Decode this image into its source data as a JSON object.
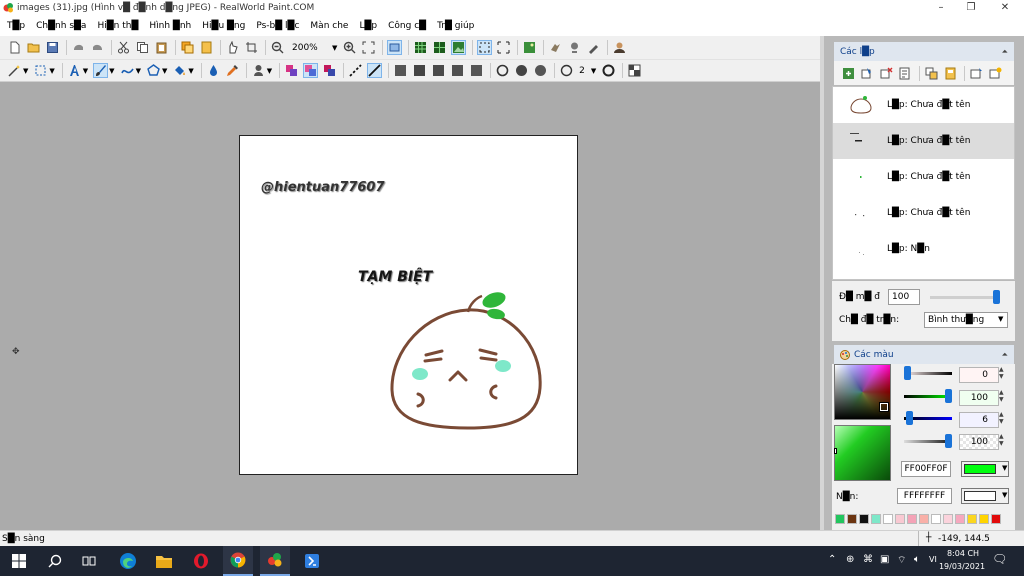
{
  "window": {
    "title": "images (31).jpg (Hình v█ đ█nh d█ng JPEG) - RealWorld Paint.COM",
    "minimize": "–",
    "maximize": "❐",
    "close": "✕"
  },
  "menu": [
    "T█p",
    "Ch█nh s█a",
    "Hi█n th█",
    "Hình █nh",
    "Hi█u █ng",
    "Ps-b█ l█c",
    "Màn che",
    "L█p",
    "Công c█",
    "Tr█ giúp"
  ],
  "toolbar": {
    "zoom_value": "200%",
    "brush_size": "2"
  },
  "canvas": {
    "watermark": "@hientuan77607",
    "caption": "TẠM BIỆT"
  },
  "layers_panel": {
    "title": "Các l█p",
    "items": [
      {
        "name": "L█p: Chưa đ█t tên"
      },
      {
        "name": "L█p: Chưa đ█t tên"
      },
      {
        "name": "L█p: Chưa đ█t tên"
      },
      {
        "name": "L█p: Chưa đ█t tên"
      },
      {
        "name": "L█p: N█n"
      }
    ],
    "opacity_label": "Đ█ m█ đ",
    "opacity_value": "100",
    "opacity_fraction": 1.0,
    "blend_label": "Ch█ đ█ tr█n:",
    "blend_value": "Bình thư█ng"
  },
  "colors_panel": {
    "title": "Các màu",
    "sliders": [
      {
        "value": "0",
        "fraction": 0.0
      },
      {
        "value": "100",
        "fraction": 1.0
      },
      {
        "value": "6",
        "fraction": 0.06
      },
      {
        "value": "100",
        "fraction": 1.0
      }
    ],
    "foreground_hex_text": "FF00FF0F",
    "background_label": "N█n:",
    "background_hex_text": "FFFFFFFF",
    "foreground_color": "#00ff0f",
    "background_color": "#ffffff",
    "palette": [
      "#22c55e",
      "#6b3410",
      "#111111",
      "#7ee8c9",
      "#ffffff",
      "#f9c9d2",
      "#f4a3b7",
      "#f9b0a8",
      "#ffffff",
      "#fbd3dc",
      "#f6a8be",
      "#fbd61f",
      "#ffd400",
      "#e10a0a"
    ]
  },
  "status": {
    "text": "S█n sàng",
    "coords": "-149, 144.5"
  },
  "taskbar": {
    "time": "8:04 CH",
    "date": "19/03/2021",
    "lang": "VI"
  }
}
